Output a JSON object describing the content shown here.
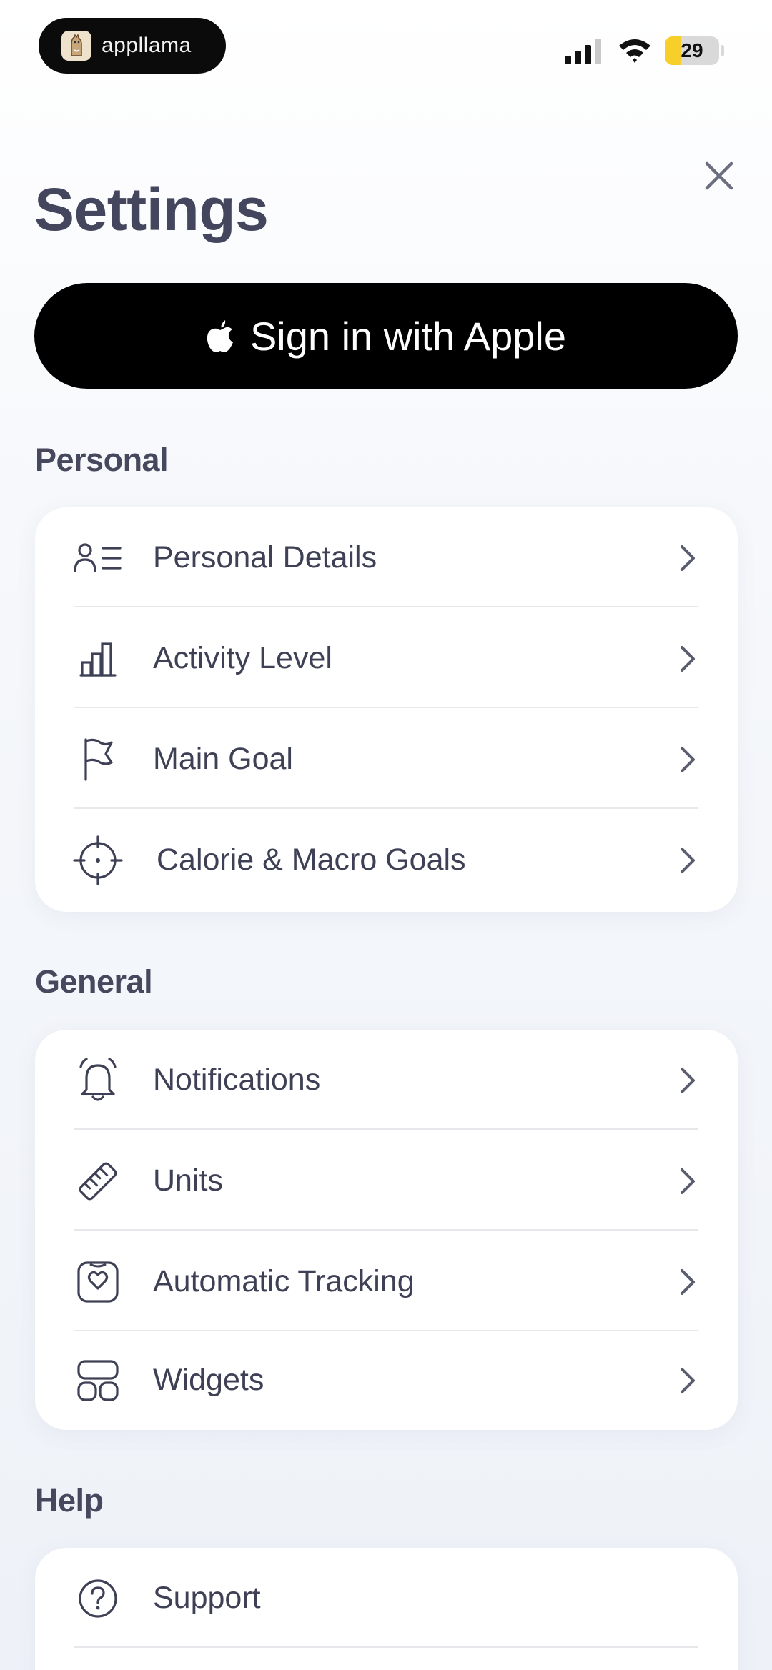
{
  "status_bar": {
    "app_name": "appllama",
    "battery": "29",
    "battery_level": 0.29
  },
  "header": {
    "title": "Settings",
    "close_icon": "close-icon"
  },
  "sign_in": {
    "label": "Sign in with Apple",
    "icon": "apple-icon"
  },
  "sections": {
    "personal": {
      "title": "Personal",
      "items": [
        {
          "label": "Personal Details",
          "icon": "person-list-icon"
        },
        {
          "label": "Activity Level",
          "icon": "bar-chart-icon"
        },
        {
          "label": "Main Goal",
          "icon": "flag-icon"
        },
        {
          "label": "Calorie & Macro Goals",
          "icon": "target-icon"
        }
      ]
    },
    "general": {
      "title": "General",
      "items": [
        {
          "label": "Notifications",
          "icon": "bell-icon"
        },
        {
          "label": "Units",
          "icon": "ruler-icon"
        },
        {
          "label": "Automatic Tracking",
          "icon": "heart-watch-icon"
        },
        {
          "label": "Widgets",
          "icon": "widgets-icon"
        }
      ]
    },
    "help": {
      "title": "Help",
      "items": [
        {
          "label": "Support",
          "icon": "question-icon"
        }
      ]
    }
  },
  "colors": {
    "text": "#3e4055",
    "title": "#44465d",
    "button_bg": "#000000",
    "card_bg": "#ffffff",
    "battery_fill": "#f7cf2a"
  }
}
